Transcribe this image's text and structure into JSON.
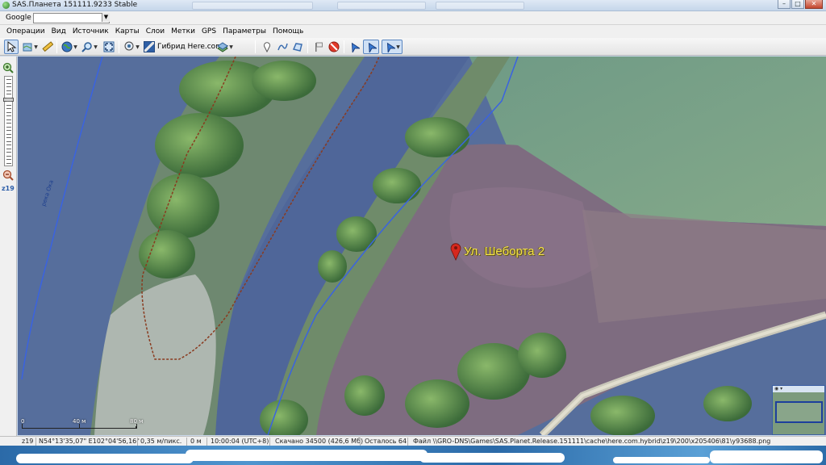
{
  "window": {
    "title": "SAS.Планета 151111.9233 Stable",
    "buttons": {
      "minimize": "–",
      "maximize": "□",
      "close": "✕"
    }
  },
  "address_bar": {
    "source_label": "Google",
    "search_value": ""
  },
  "menu": [
    "Операции",
    "Вид",
    "Источник",
    "Карты",
    "Слои",
    "Метки",
    "GPS",
    "Параметры",
    "Помощь"
  ],
  "toolbar": {
    "map_label": "Гибрид Here.com"
  },
  "zoom_panel": {
    "zoom_label": "z19",
    "level_fraction": 0.25
  },
  "map": {
    "placemark_label": "Ул. Шеборта 2",
    "river_label": "река Ока",
    "scale": {
      "labels": [
        "0",
        "40 м",
        "80 м"
      ]
    },
    "colors": {
      "route_blue": "#3a63e0",
      "path_brown": "#8a3b1f",
      "placemark_red": "#d6281e"
    }
  },
  "status_bar": {
    "zoom": "z19",
    "coordinates": "N54°13'35,07\" E102°04'56,16\"",
    "resolution": "0,35 м/пикс.",
    "altitude": "0 м",
    "time": "10:00:04 (UTC+8)",
    "downloaded": "Скачано 34500 (426,6 Мб)",
    "remaining": "Осталось 64",
    "file": "Файл \\\\GRO-DNS\\Games\\SAS.Planet.Release.151111\\cache\\here.com.hybrid\\z19\\200\\x205406\\81\\y93688.png"
  }
}
